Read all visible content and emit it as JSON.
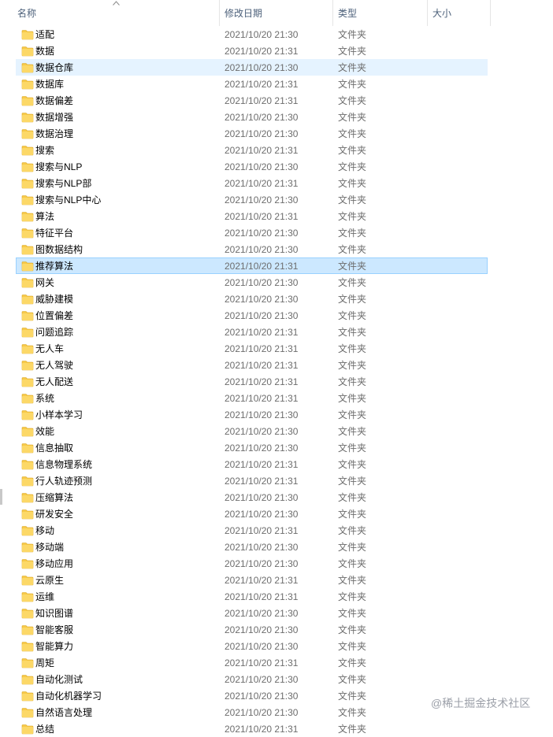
{
  "header": {
    "name_label": "名称",
    "date_label": "修改日期",
    "type_label": "类型",
    "size_label": "大小"
  },
  "sort_icon": "chevron-up-icon",
  "folder_icon": "folder-icon",
  "folder_color": "#f7c948",
  "selection_color": "#cce8ff",
  "hover_color": "#e5f3ff",
  "files": [
    {
      "name": "适配",
      "date": "2021/10/20 21:30",
      "type": "文件夹"
    },
    {
      "name": "数据",
      "date": "2021/10/20 21:31",
      "type": "文件夹"
    },
    {
      "name": "数据仓库",
      "date": "2021/10/20 21:30",
      "type": "文件夹",
      "state": "hover"
    },
    {
      "name": "数据库",
      "date": "2021/10/20 21:31",
      "type": "文件夹"
    },
    {
      "name": "数据偏差",
      "date": "2021/10/20 21:31",
      "type": "文件夹"
    },
    {
      "name": "数据增强",
      "date": "2021/10/20 21:30",
      "type": "文件夹"
    },
    {
      "name": "数据治理",
      "date": "2021/10/20 21:30",
      "type": "文件夹"
    },
    {
      "name": "搜索",
      "date": "2021/10/20 21:31",
      "type": "文件夹"
    },
    {
      "name": "搜索与NLP",
      "date": "2021/10/20 21:30",
      "type": "文件夹"
    },
    {
      "name": "搜索与NLP部",
      "date": "2021/10/20 21:31",
      "type": "文件夹"
    },
    {
      "name": "搜索与NLP中心",
      "date": "2021/10/20 21:30",
      "type": "文件夹"
    },
    {
      "name": "算法",
      "date": "2021/10/20 21:31",
      "type": "文件夹"
    },
    {
      "name": "特征平台",
      "date": "2021/10/20 21:30",
      "type": "文件夹"
    },
    {
      "name": "图数据结构",
      "date": "2021/10/20 21:30",
      "type": "文件夹"
    },
    {
      "name": "推荐算法",
      "date": "2021/10/20 21:31",
      "type": "文件夹",
      "state": "selected"
    },
    {
      "name": "网关",
      "date": "2021/10/20 21:30",
      "type": "文件夹"
    },
    {
      "name": "威胁建模",
      "date": "2021/10/20 21:30",
      "type": "文件夹"
    },
    {
      "name": "位置偏差",
      "date": "2021/10/20 21:30",
      "type": "文件夹"
    },
    {
      "name": "问题追踪",
      "date": "2021/10/20 21:31",
      "type": "文件夹"
    },
    {
      "name": "无人车",
      "date": "2021/10/20 21:31",
      "type": "文件夹"
    },
    {
      "name": "无人驾驶",
      "date": "2021/10/20 21:31",
      "type": "文件夹"
    },
    {
      "name": "无人配送",
      "date": "2021/10/20 21:31",
      "type": "文件夹"
    },
    {
      "name": "系统",
      "date": "2021/10/20 21:31",
      "type": "文件夹"
    },
    {
      "name": "小样本学习",
      "date": "2021/10/20 21:30",
      "type": "文件夹"
    },
    {
      "name": "效能",
      "date": "2021/10/20 21:30",
      "type": "文件夹"
    },
    {
      "name": "信息抽取",
      "date": "2021/10/20 21:30",
      "type": "文件夹"
    },
    {
      "name": "信息物理系统",
      "date": "2021/10/20 21:31",
      "type": "文件夹"
    },
    {
      "name": "行人轨迹预测",
      "date": "2021/10/20 21:31",
      "type": "文件夹"
    },
    {
      "name": "压缩算法",
      "date": "2021/10/20 21:30",
      "type": "文件夹"
    },
    {
      "name": "研发安全",
      "date": "2021/10/20 21:30",
      "type": "文件夹"
    },
    {
      "name": "移动",
      "date": "2021/10/20 21:31",
      "type": "文件夹"
    },
    {
      "name": "移动端",
      "date": "2021/10/20 21:30",
      "type": "文件夹"
    },
    {
      "name": "移动应用",
      "date": "2021/10/20 21:30",
      "type": "文件夹"
    },
    {
      "name": "云原生",
      "date": "2021/10/20 21:31",
      "type": "文件夹"
    },
    {
      "name": "运维",
      "date": "2021/10/20 21:31",
      "type": "文件夹"
    },
    {
      "name": "知识图谱",
      "date": "2021/10/20 21:30",
      "type": "文件夹"
    },
    {
      "name": "智能客服",
      "date": "2021/10/20 21:30",
      "type": "文件夹"
    },
    {
      "name": "智能算力",
      "date": "2021/10/20 21:30",
      "type": "文件夹"
    },
    {
      "name": "周矩",
      "date": "2021/10/20 21:31",
      "type": "文件夹"
    },
    {
      "name": "自动化测试",
      "date": "2021/10/20 21:30",
      "type": "文件夹"
    },
    {
      "name": "自动化机器学习",
      "date": "2021/10/20 21:30",
      "type": "文件夹"
    },
    {
      "name": "自然语言处理",
      "date": "2021/10/20 21:30",
      "type": "文件夹"
    },
    {
      "name": "总结",
      "date": "2021/10/20 21:31",
      "type": "文件夹"
    }
  ],
  "watermark": "@稀土掘金技术社区"
}
